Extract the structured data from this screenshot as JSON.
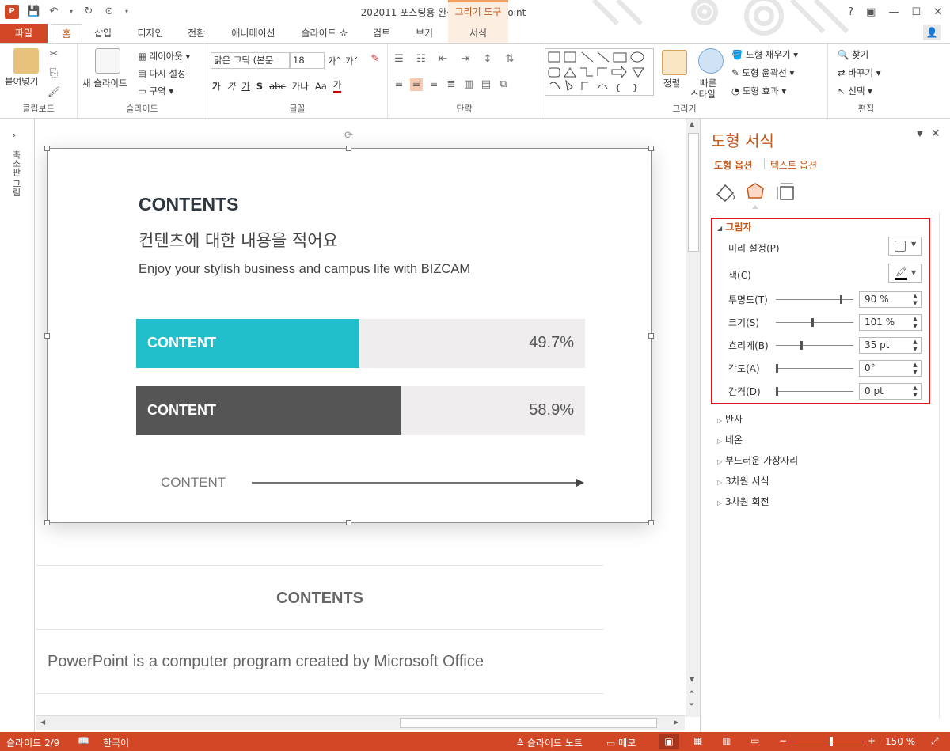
{
  "app": {
    "title": "202011 포스팅용 완성본 - PowerPoint",
    "contextual_group": "그리기 도구",
    "window_controls": [
      "?",
      "▣",
      "—",
      "☐",
      "✕"
    ]
  },
  "tabs": {
    "file": "파일",
    "items": [
      "홈",
      "삽입",
      "디자인",
      "전환",
      "애니메이션",
      "슬라이드 쇼",
      "검토",
      "보기",
      "서식"
    ],
    "active": "홈"
  },
  "ribbon": {
    "clipboard": {
      "label": "클립보드",
      "paste": "붙여넣기"
    },
    "slides": {
      "label": "슬라이드",
      "new_slide": "새 슬라이드",
      "layout": "레이아웃",
      "reset": "다시 설정",
      "section": "구역"
    },
    "font": {
      "label": "글꼴",
      "font_name": "맑은 고딕 (본문",
      "font_size": "18",
      "spacing": "가나",
      "case": "Aa",
      "clear": "가"
    },
    "paragraph": {
      "label": "단락"
    },
    "drawing": {
      "label": "그리기",
      "arrange": "정렬",
      "quick_styles": "빠른",
      "quick_styles2": "스타일",
      "fill": "도형 채우기",
      "outline": "도형 윤곽선",
      "effects": "도형 효과"
    },
    "editing": {
      "label": "편집",
      "find": "찾기",
      "replace": "바꾸기",
      "select": "선택"
    }
  },
  "thumbnail_pane": {
    "label": "축소판 그림"
  },
  "slide": {
    "heading": "CONTENTS",
    "subheading": "컨텐츠에 대한 내용을 적어요",
    "tagline": "Enjoy your stylish business and campus life with BIZCAM",
    "bars": [
      {
        "label": "CONTENT",
        "value_text": "49.7%",
        "value": 49.7,
        "color": "#21bfcb"
      },
      {
        "label": "CONTENT",
        "value_text": "58.9%",
        "value": 58.9,
        "color": "#555555"
      }
    ],
    "arrow_label": "CONTENT"
  },
  "next_slide": {
    "heading": "CONTENTS",
    "body": "PowerPoint is a computer program created by Microsoft Office"
  },
  "format_pane": {
    "title": "도형 서식",
    "tab_shape": "도형 옵션",
    "tab_text": "텍스트 옵션",
    "shadow_section": "그림자",
    "preset": "미리 설정(P)",
    "color": "색(C)",
    "params": [
      {
        "label": "투명도(T)",
        "value": "90 %",
        "slider": 0.9
      },
      {
        "label": "크기(S)",
        "value": "101 %",
        "slider": 0.5
      },
      {
        "label": "흐리게(B)",
        "value": "35 pt",
        "slider": 0.35
      },
      {
        "label": "각도(A)",
        "value": "0°",
        "slider": 0.0
      },
      {
        "label": "간격(D)",
        "value": "0 pt",
        "slider": 0.0
      }
    ],
    "sections": [
      "반사",
      "네온",
      "부드러운 가장자리",
      "3차원 서식",
      "3차원 회전"
    ]
  },
  "status": {
    "slide": "슬라이드 2/9",
    "language": "한국어",
    "notes": "슬라이드 노트",
    "comments": "메모",
    "zoom": "150 %"
  },
  "colors": {
    "accent": "#d24726",
    "highlight": "#e0161a",
    "teal": "#21bfcb",
    "dark": "#555555"
  }
}
